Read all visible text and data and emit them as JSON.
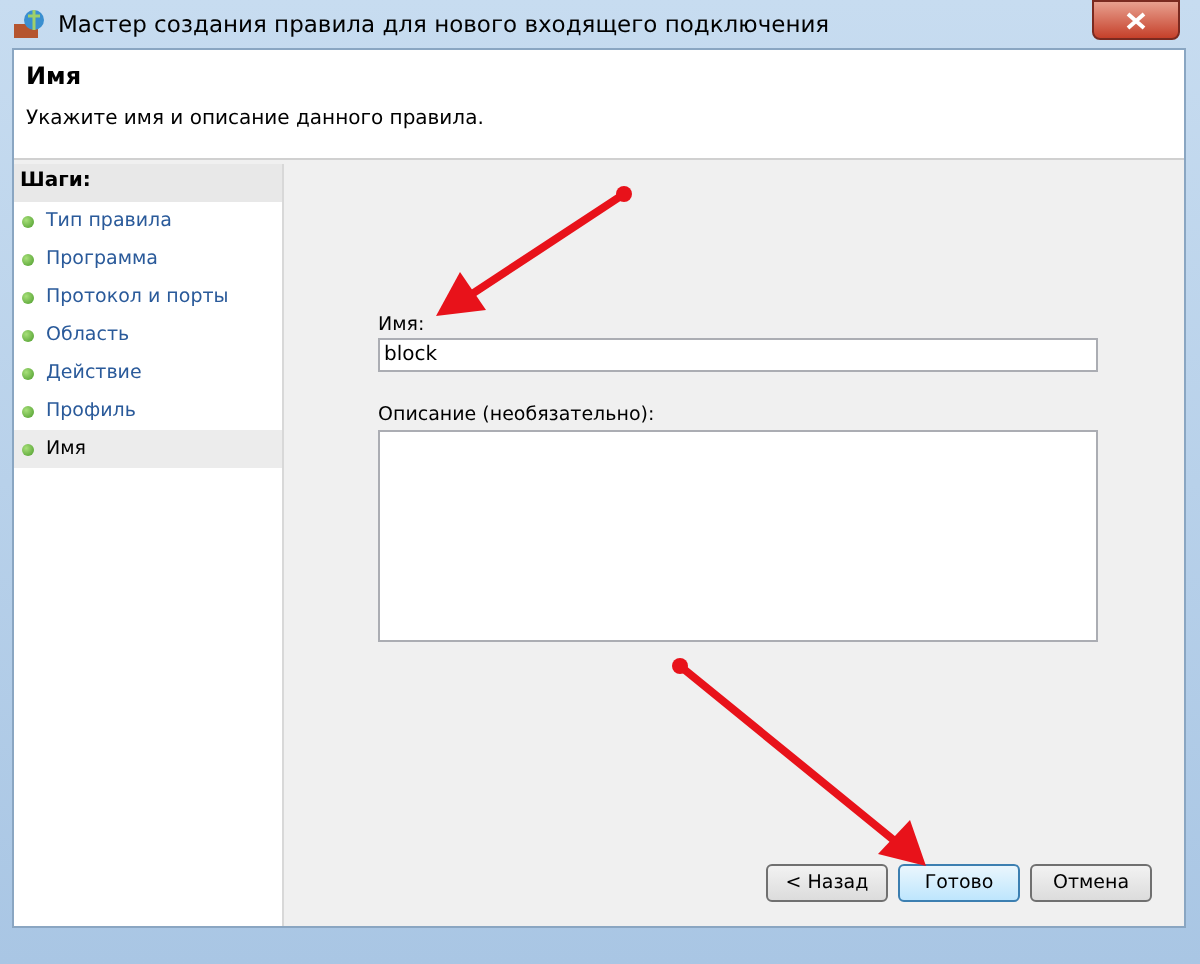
{
  "window": {
    "title": "Мастер создания правила для нового входящего подключения"
  },
  "header": {
    "title": "Имя",
    "subtitle": "Укажите имя и описание данного правила."
  },
  "steps": {
    "title": "Шаги:",
    "items": [
      {
        "label": "Тип правила",
        "selected": false
      },
      {
        "label": "Программа",
        "selected": false
      },
      {
        "label": "Протокол и порты",
        "selected": false
      },
      {
        "label": "Область",
        "selected": false
      },
      {
        "label": "Действие",
        "selected": false
      },
      {
        "label": "Профиль",
        "selected": false
      },
      {
        "label": "Имя",
        "selected": true
      }
    ]
  },
  "form": {
    "name_label": "Имя:",
    "name_value": "block",
    "description_label": "Описание (необязательно):"
  },
  "buttons": [
    {
      "label": "< Назад",
      "default": false
    },
    {
      "label": "Готово",
      "default": true
    },
    {
      "label": "Отмена",
      "default": false
    }
  ]
}
